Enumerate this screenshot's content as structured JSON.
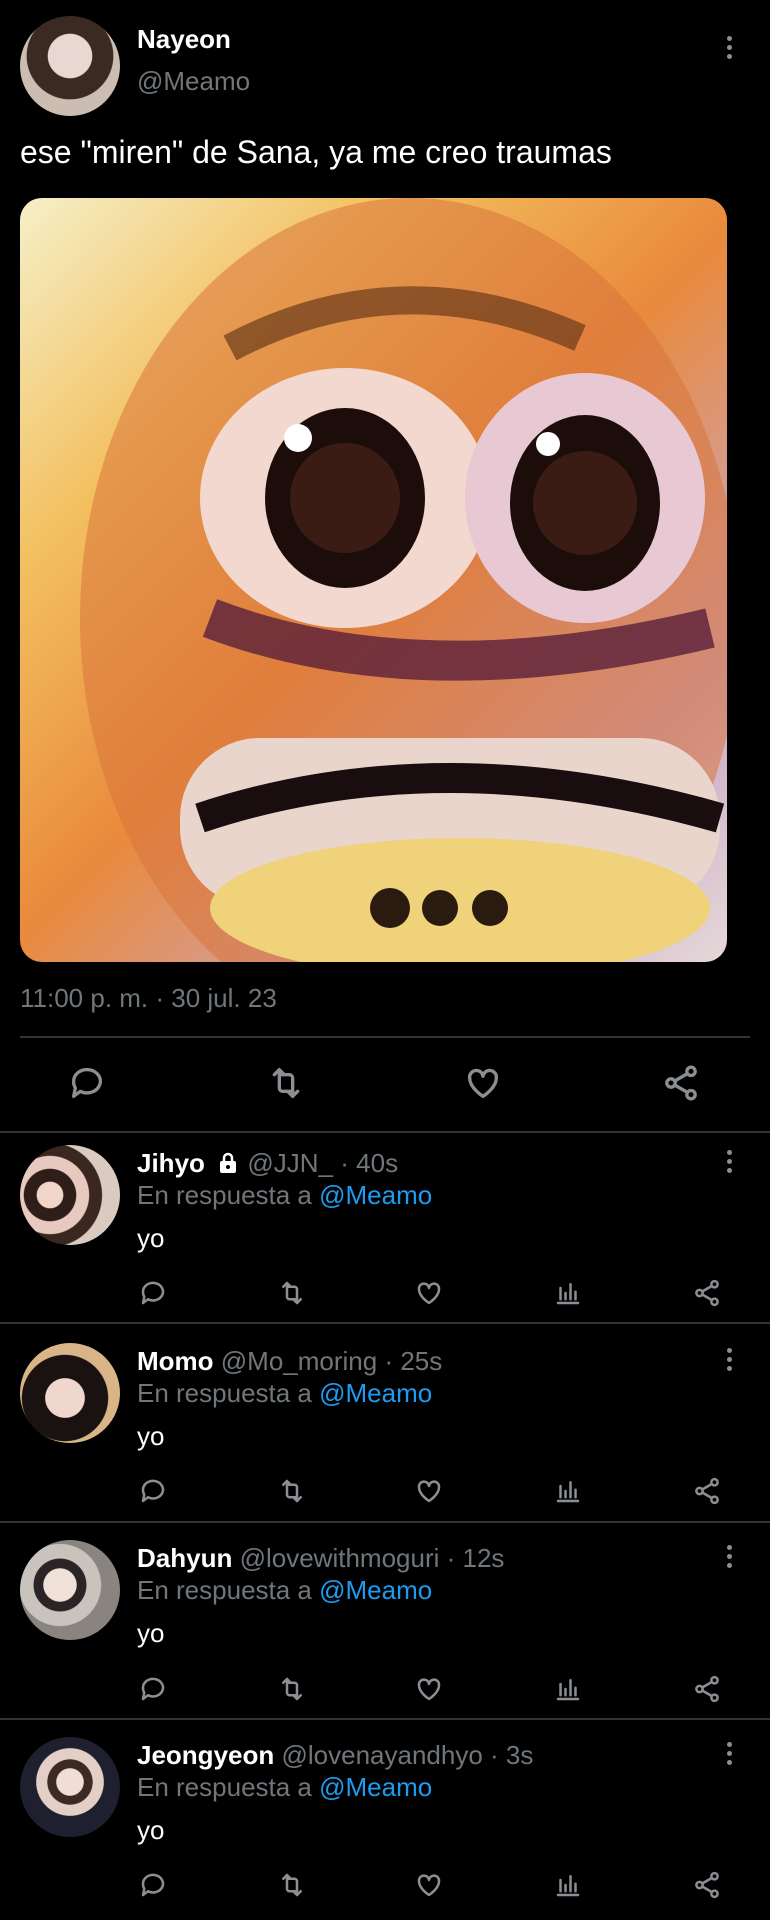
{
  "tweet": {
    "author_name": "Nayeon",
    "author_handle": "@Meamo",
    "text": "ese \"miren\" de Sana, ya me creo traumas",
    "timestamp": "11:00 p. m. · 30 jul. 23",
    "media_description_icon": "cartoon-face-image",
    "actions": [
      "reply-icon",
      "retweet-icon",
      "like-icon",
      "share-icon"
    ]
  },
  "replies": [
    {
      "name": "Jihyo",
      "locked": true,
      "handle": "@JJN_",
      "time": "· 40s",
      "reply_prefix": "En respuesta a",
      "reply_to": "@Meamo",
      "text": "yo"
    },
    {
      "name": "Momo",
      "locked": false,
      "handle": "@Mo_moring",
      "time": "· 25s",
      "reply_prefix": "En respuesta a",
      "reply_to": "@Meamo",
      "text": "yo"
    },
    {
      "name": "Dahyun",
      "locked": false,
      "handle": "@lovewithmoguri",
      "time": "· 12s",
      "reply_prefix": "En respuesta a",
      "reply_to": "@Meamo",
      "text": "yo"
    },
    {
      "name": "Jeongyeon",
      "locked": false,
      "handle": "@lovenayandhyo",
      "time": "· 3s",
      "reply_prefix": "En respuesta a",
      "reply_to": "@Meamo",
      "text": "yo"
    }
  ],
  "colors": {
    "background": "#000000",
    "link": "#1d9bf0",
    "secondary_text": "#71767b",
    "divider": "#2f3336"
  }
}
